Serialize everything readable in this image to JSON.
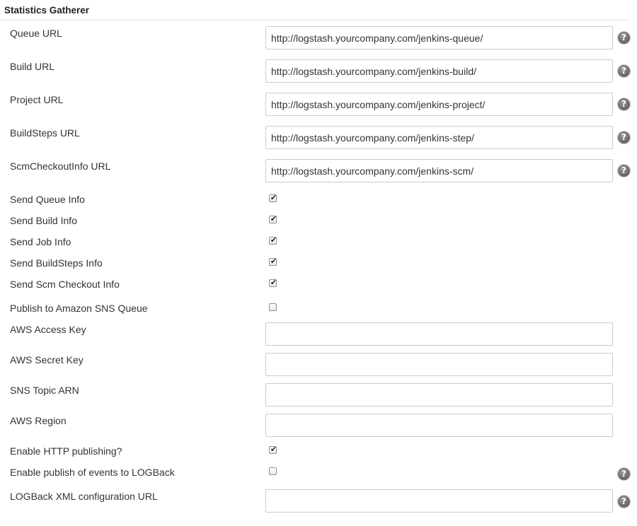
{
  "section": {
    "title": "Statistics Gatherer"
  },
  "help_icon_glyph": "?",
  "checkbox_mark": "✔",
  "fields": {
    "queue_url": {
      "label": "Queue URL",
      "value": "http://logstash.yourcompany.com/jenkins-queue/"
    },
    "build_url": {
      "label": "Build URL",
      "value": "http://logstash.yourcompany.com/jenkins-build/"
    },
    "project_url": {
      "label": "Project URL",
      "value": "http://logstash.yourcompany.com/jenkins-project/"
    },
    "buildsteps_url": {
      "label": "BuildSteps URL",
      "value": "http://logstash.yourcompany.com/jenkins-step/"
    },
    "scm_url": {
      "label": "ScmCheckoutInfo URL",
      "value": "http://logstash.yourcompany.com/jenkins-scm/"
    },
    "aws_access_key": {
      "label": "AWS Access Key",
      "value": ""
    },
    "aws_secret_key": {
      "label": "AWS Secret Key",
      "value": ""
    },
    "sns_topic_arn": {
      "label": "SNS Topic ARN",
      "value": ""
    },
    "aws_region": {
      "label": "AWS Region",
      "value": ""
    },
    "logback_url": {
      "label": "LOGBack XML configuration URL",
      "value": ""
    }
  },
  "checkboxes": {
    "send_queue": {
      "label": "Send Queue Info",
      "checked": true
    },
    "send_build": {
      "label": "Send Build Info",
      "checked": true
    },
    "send_job": {
      "label": "Send Job Info",
      "checked": true
    },
    "send_buildsteps": {
      "label": "Send BuildSteps Info",
      "checked": true
    },
    "send_scm": {
      "label": "Send Scm Checkout Info",
      "checked": true
    },
    "publish_sns": {
      "label": "Publish to Amazon SNS Queue",
      "checked": false
    },
    "enable_http": {
      "label": "Enable HTTP publishing?",
      "checked": true
    },
    "enable_logback": {
      "label": "Enable publish of events to LOGBack",
      "checked": false
    }
  }
}
